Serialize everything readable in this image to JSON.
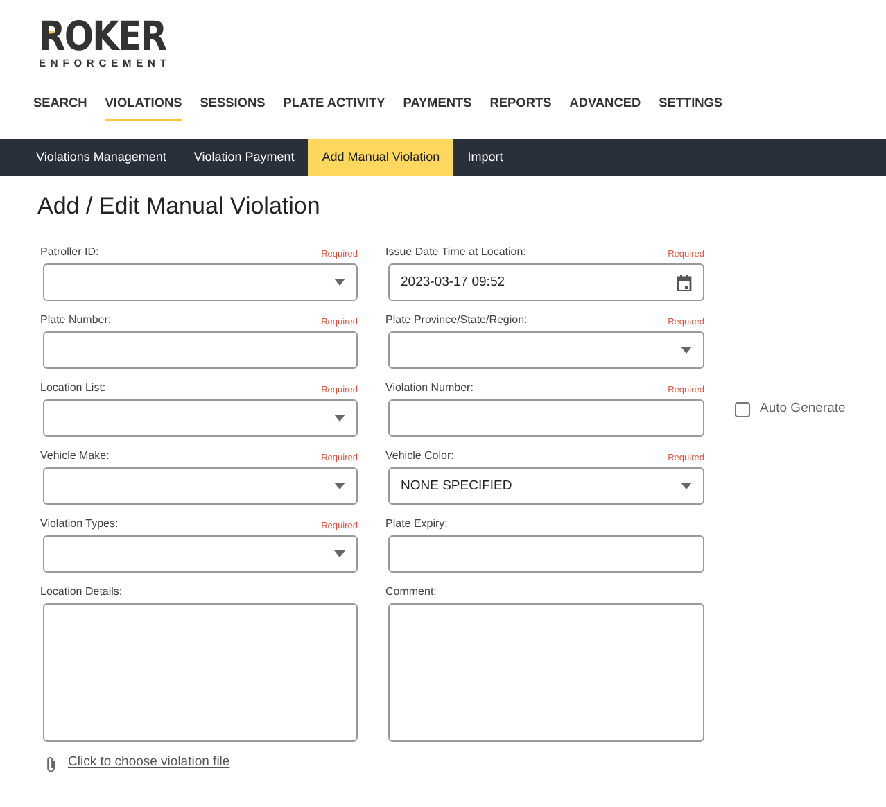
{
  "logo": {
    "name": "ROKER",
    "tagline": "ENFORCEMENT"
  },
  "main_nav": [
    {
      "label": "SEARCH",
      "selected": false
    },
    {
      "label": "VIOLATIONS",
      "selected": true
    },
    {
      "label": "SESSIONS",
      "selected": false
    },
    {
      "label": "PLATE ACTIVITY",
      "selected": false
    },
    {
      "label": "PAYMENTS",
      "selected": false
    },
    {
      "label": "REPORTS",
      "selected": false
    },
    {
      "label": "ADVANCED",
      "selected": false
    },
    {
      "label": "SETTINGS",
      "selected": false
    }
  ],
  "sub_nav": [
    {
      "label": "Violations Management",
      "selected": false
    },
    {
      "label": "Violation Payment",
      "selected": false
    },
    {
      "label": "Add Manual Violation",
      "selected": true
    },
    {
      "label": "Import",
      "selected": false
    }
  ],
  "page_title": "Add / Edit Manual Violation",
  "form_rows": [
    [
      {
        "label": "Patroller ID:",
        "kind": "select",
        "note": "Required"
      },
      {
        "label": "Issue Date Time at Location:",
        "kind": "date",
        "note": "Required",
        "value": "2023-03-17 09:52"
      }
    ],
    [
      {
        "label": "Plate Number:",
        "kind": "input",
        "note": "Required"
      },
      {
        "label": "Plate Province/State/Region:",
        "kind": "select",
        "note": "Required"
      }
    ],
    [
      {
        "label": "Location List:",
        "kind": "select",
        "note": "Required"
      },
      {
        "label": "Violation Number:",
        "kind": "input",
        "note": "Required",
        "option": {
          "label": "Auto Generate",
          "checked": false
        }
      }
    ],
    [
      {
        "label": "Vehicle Make:",
        "kind": "select",
        "note": "Required"
      },
      {
        "label": "Vehicle Color:",
        "kind": "select",
        "note": "Required",
        "value": "NONE SPECIFIED"
      }
    ],
    [
      {
        "label": "Violation Types:",
        "kind": "select",
        "note": "Required"
      },
      {
        "label": "Plate Expiry:",
        "kind": "input"
      }
    ],
    [
      {
        "label": "Location Details:",
        "kind": "textarea"
      },
      {
        "label": "Comment:",
        "kind": "textarea"
      }
    ]
  ],
  "file_link": "Click to choose violation file"
}
